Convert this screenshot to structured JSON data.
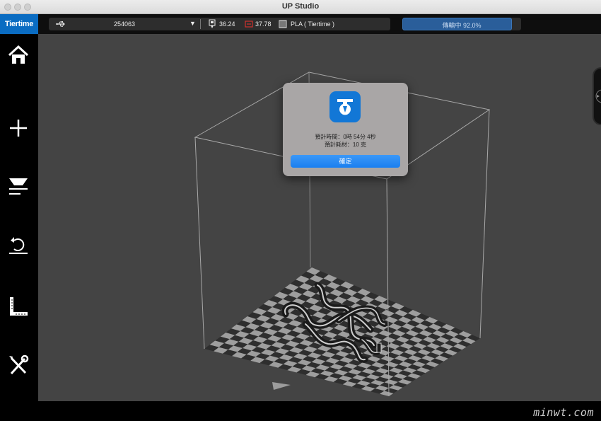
{
  "window": {
    "title": "UP Studio"
  },
  "brand": {
    "label": "Tiertime"
  },
  "device_bar": {
    "printer_id": "254063",
    "nozzle_temp": "36.24",
    "bed_temp": "37.78",
    "material": "PLA ( Tiertime )"
  },
  "progress": {
    "label": "傳輸中 92.0%",
    "value": 0.92
  },
  "dialog": {
    "time_line": "預計時間：0時 54分 4秒",
    "material_line": "預計耗材：10 克",
    "ok_label": "確定"
  },
  "watermark": {
    "text": "minwt.com"
  },
  "colors": {
    "brand": "#0a6cc2",
    "progress_fill": "#2a5e9a",
    "ok_button": "#1a7ff0",
    "viewport_bg": "#444444",
    "bed_temp_icon": "#d0312d"
  },
  "sidebar": {
    "items": [
      {
        "name": "home-icon"
      },
      {
        "name": "add-icon"
      },
      {
        "name": "print-icon"
      },
      {
        "name": "undo-icon"
      },
      {
        "name": "calibrate-icon"
      },
      {
        "name": "tools-icon"
      }
    ]
  }
}
